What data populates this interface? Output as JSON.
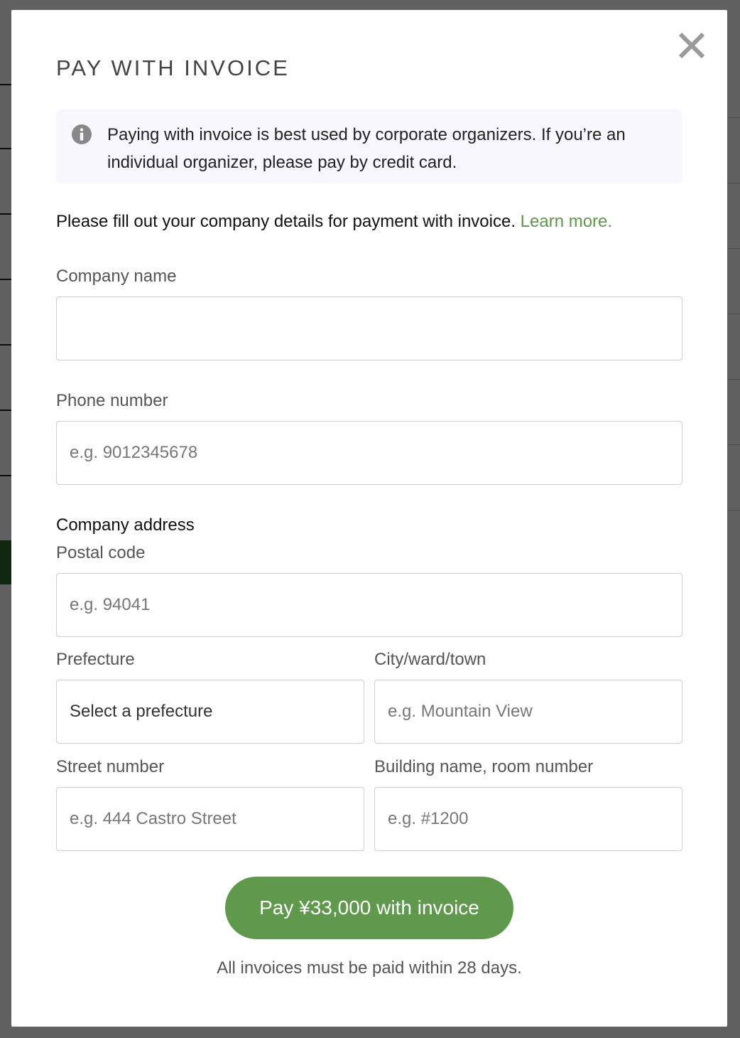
{
  "modal": {
    "title": "PAY WITH INVOICE",
    "close_icon": "close-icon",
    "info": {
      "icon": "info-icon",
      "text": "Paying with invoice is best used by corporate organizers. If you’re an individual organizer, please pay by credit card."
    },
    "intro_text": "Please fill out your company details for payment with invoice.",
    "learn_more": "Learn more.",
    "fields": {
      "company_name": {
        "label": "Company name",
        "value": "",
        "placeholder": ""
      },
      "phone": {
        "label": "Phone number",
        "value": "",
        "placeholder": "e.g. 9012345678"
      },
      "address_heading": "Company address",
      "postal_code": {
        "label": "Postal code",
        "value": "",
        "placeholder": "e.g. 94041"
      },
      "prefecture": {
        "label": "Prefecture",
        "selected": "Select a prefecture"
      },
      "city": {
        "label": "City/ward/town",
        "value": "",
        "placeholder": "e.g. Mountain View"
      },
      "street": {
        "label": "Street number",
        "value": "",
        "placeholder": "e.g. 444 Castro Street"
      },
      "building": {
        "label": "Building name, room number",
        "value": "",
        "placeholder": "e.g. #1200"
      }
    },
    "pay_button": "Pay ¥33,000 with invoice",
    "footnote": "All invoices must be paid within 28 days."
  },
  "colors": {
    "accent_green": "#5f9a4c",
    "link_green": "#5b9a48",
    "info_bg": "#f7f7fd"
  }
}
